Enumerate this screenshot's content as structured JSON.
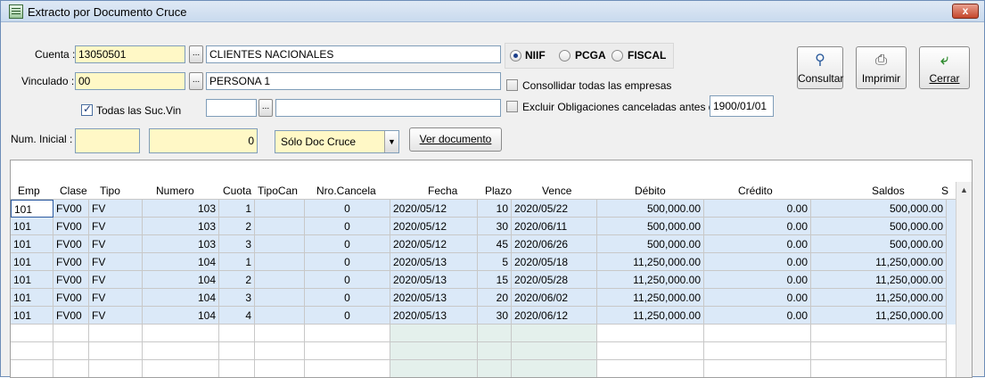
{
  "window": {
    "title": "Extracto por Documento Cruce",
    "close_label": "x"
  },
  "form": {
    "cuenta_label": "Cuenta :",
    "cuenta_value": "13050501",
    "cuenta_name": "CLIENTES NACIONALES",
    "vinculado_label": "Vinculado :",
    "vinculado_value": "00",
    "vinculado_name": "PERSONA 1",
    "todas_label": "Todas las Suc.Vin",
    "todas_checked": true,
    "dots_label": "...",
    "num_inicial_label": "Num. Inicial :",
    "num_inicial_value": "",
    "num_final_value": "0",
    "doc_select": "Sólo Doc Cruce",
    "ver_documento_label": "Ver documento"
  },
  "radios": [
    {
      "label": "NIIF",
      "checked": true
    },
    {
      "label": "PCGA",
      "checked": false
    },
    {
      "label": "FISCAL",
      "checked": false
    }
  ],
  "options": {
    "consolidar_label": "Consollidar todas las empresas",
    "excluir_label": "Excluir Obligaciones canceladas antes de",
    "excluir_date": "1900/01/01"
  },
  "toolbar": {
    "consultar": "Consultar",
    "imprimir": "Imprimir",
    "cerrar": "Cerrar"
  },
  "table": {
    "columns": [
      "Emp",
      "Clase",
      "Tipo",
      "Numero",
      "Cuota",
      "TipoCan",
      "Nro.Cancela",
      "Fecha",
      "Plazo",
      "Vence",
      "Débito",
      "Crédito",
      "Saldos",
      "S"
    ],
    "rows": [
      [
        "101",
        "FV00",
        "FV",
        "103",
        "1",
        "",
        "0",
        "2020/05/12",
        "10",
        "2020/05/22",
        "500,000.00",
        "0.00",
        "500,000.00"
      ],
      [
        "101",
        "FV00",
        "FV",
        "103",
        "2",
        "",
        "0",
        "2020/05/12",
        "30",
        "2020/06/11",
        "500,000.00",
        "0.00",
        "500,000.00"
      ],
      [
        "101",
        "FV00",
        "FV",
        "103",
        "3",
        "",
        "0",
        "2020/05/12",
        "45",
        "2020/06/26",
        "500,000.00",
        "0.00",
        "500,000.00"
      ],
      [
        "101",
        "FV00",
        "FV",
        "104",
        "1",
        "",
        "0",
        "2020/05/13",
        "5",
        "2020/05/18",
        "11,250,000.00",
        "0.00",
        "11,250,000.00"
      ],
      [
        "101",
        "FV00",
        "FV",
        "104",
        "2",
        "",
        "0",
        "2020/05/13",
        "15",
        "2020/05/28",
        "11,250,000.00",
        "0.00",
        "11,250,000.00"
      ],
      [
        "101",
        "FV00",
        "FV",
        "104",
        "3",
        "",
        "0",
        "2020/05/13",
        "20",
        "2020/06/02",
        "11,250,000.00",
        "0.00",
        "11,250,000.00"
      ],
      [
        "101",
        "FV00",
        "FV",
        "104",
        "4",
        "",
        "0",
        "2020/05/13",
        "30",
        "2020/06/12",
        "11,250,000.00",
        "0.00",
        "11,250,000.00"
      ]
    ]
  }
}
